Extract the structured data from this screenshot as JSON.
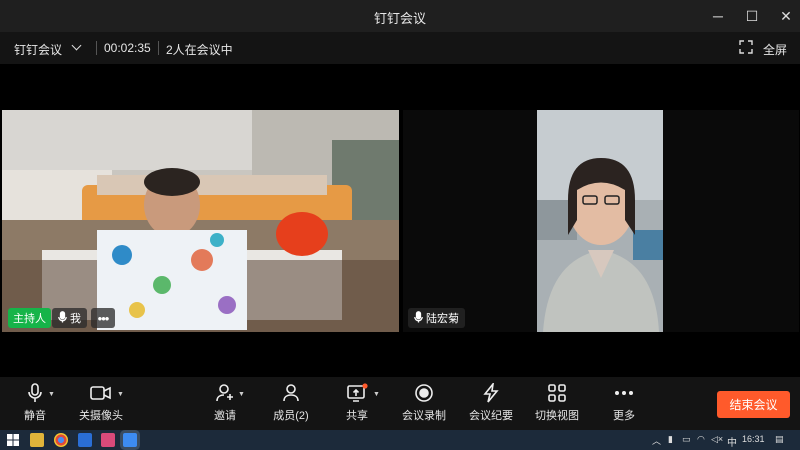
{
  "window": {
    "title": "钉钉会议",
    "controls": {
      "minimize": "─",
      "maximize": "☐",
      "close": "✕"
    }
  },
  "infobar": {
    "app_menu": "钉钉会议",
    "duration": "00:02:35",
    "participants_status": "2人在会议中",
    "fullscreen_label": "全屏"
  },
  "participants": [
    {
      "name": "我",
      "role_badge": "主持人",
      "more": "•••"
    },
    {
      "name": "陆宏菊"
    }
  ],
  "toolbar": {
    "mute": "静音",
    "camera": "关摄像头",
    "invite": "邀请",
    "members": "成员(2)",
    "share": "共享",
    "record": "会议录制",
    "minutes": "会议纪要",
    "switch_view": "切换视图",
    "more": "更多",
    "end": "结束会议"
  },
  "taskbar": {
    "ime": "中",
    "clock": "16:31"
  },
  "colors": {
    "host_badge": "#16b449",
    "end_button": "#ff5a2b",
    "share_dot": "#ff5a2b"
  }
}
